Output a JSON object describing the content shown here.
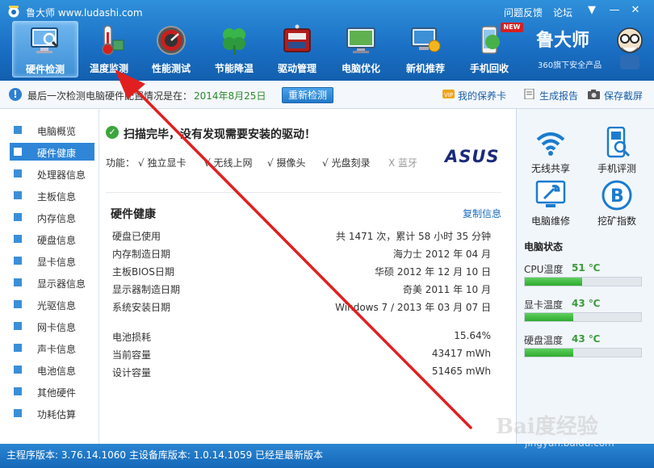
{
  "window": {
    "app_title": "鲁大师 www.ludashi.com",
    "links": [
      "问题反馈",
      "论坛"
    ]
  },
  "toolbar": {
    "items": [
      {
        "label": "硬件检测",
        "icon": "monitor-magnifier-icon",
        "active": true
      },
      {
        "label": "温度监测",
        "icon": "thermometer-icon",
        "active": false
      },
      {
        "label": "性能测试",
        "icon": "speedometer-icon",
        "active": false
      },
      {
        "label": "节能降温",
        "icon": "clover-leaf-icon",
        "active": false
      },
      {
        "label": "驱动管理",
        "icon": "driver-chip-icon",
        "active": false
      },
      {
        "label": "电脑优化",
        "icon": "screen-broom-icon",
        "active": false
      },
      {
        "label": "新机推荐",
        "icon": "computer-medal-icon",
        "active": false
      },
      {
        "label": "手机回收",
        "icon": "phone-recycle-icon",
        "active": false
      }
    ],
    "new_badge": "NEW"
  },
  "brand": {
    "name": "鲁大师",
    "subtitle": "360旗下安全产品"
  },
  "infobar": {
    "text": "最后一次检测电脑硬件配置情况是在：",
    "date": "2014年8月25日",
    "recheck_button": "重新检测",
    "links": [
      "我的保养卡",
      "生成报告",
      "保存截屏"
    ]
  },
  "sidebar": {
    "items": [
      {
        "label": "电脑概览",
        "active": false
      },
      {
        "label": "硬件健康",
        "active": true
      },
      {
        "label": "处理器信息",
        "active": false
      },
      {
        "label": "主板信息",
        "active": false
      },
      {
        "label": "内存信息",
        "active": false
      },
      {
        "label": "硬盘信息",
        "active": false
      },
      {
        "label": "显卡信息",
        "active": false
      },
      {
        "label": "显示器信息",
        "active": false
      },
      {
        "label": "光驱信息",
        "active": false
      },
      {
        "label": "网卡信息",
        "active": false
      },
      {
        "label": "声卡信息",
        "active": false
      },
      {
        "label": "电池信息",
        "active": false
      },
      {
        "label": "其他硬件",
        "active": false
      },
      {
        "label": "功耗估算",
        "active": false
      }
    ]
  },
  "scan": {
    "title": "扫描完毕，没有发现需要安装的驱动！",
    "features_label": "功能：",
    "features": [
      {
        "label": "√ 独立显卡",
        "available": true
      },
      {
        "label": "√ 无线上网",
        "available": true
      },
      {
        "label": "√ 摄像头",
        "available": true
      },
      {
        "label": "√ 光盘刻录",
        "available": true
      },
      {
        "label": "X 蓝牙",
        "available": false
      }
    ],
    "vendor_logo": "ASUS"
  },
  "health": {
    "title": "硬件健康",
    "copy_link": "复制信息",
    "rows": [
      {
        "label": "硬盘已使用",
        "value": "共 1471 次，累计 58 小时 35 分钟"
      },
      {
        "label": "内存制造日期",
        "value": "海力士 2012 年 04 月"
      },
      {
        "label": "主板BIOS日期",
        "value": "华硕 2012 年 12 月 10 日"
      },
      {
        "label": "显示器制造日期",
        "value": "奇美 2011 年 10 月"
      },
      {
        "label": "系统安装日期",
        "value": "Windows 7 / 2013 年 03 月 07 日"
      }
    ],
    "battery_rows": [
      {
        "label": "电池损耗",
        "value": "15.64%"
      },
      {
        "label": "当前容量",
        "value": "43417 mWh"
      },
      {
        "label": "设计容量",
        "value": "51465 mWh"
      }
    ]
  },
  "right_panel": {
    "tools": [
      {
        "label": "无线共享",
        "icon": "wifi-icon"
      },
      {
        "label": "手机评测",
        "icon": "phone-test-icon"
      },
      {
        "label": "电脑维修",
        "icon": "wrench-screen-icon"
      },
      {
        "label": "挖矿指数",
        "icon": "bitcoin-icon"
      }
    ],
    "status_title": "电脑状态",
    "temps": [
      {
        "label": "CPU温度",
        "value": "51 ℃",
        "level": 0.49
      },
      {
        "label": "显卡温度",
        "value": "43 ℃",
        "level": 0.42
      },
      {
        "label": "硬盘温度",
        "value": "43 ℃",
        "level": 0.42
      }
    ]
  },
  "statusbar": {
    "text": "主程序版本: 3.76.14.1060   主设备库版本: 1.0.14.1059   已经是最新版本"
  },
  "watermark": {
    "main": "Bai度经验",
    "sub": "jingyan.baidu.com"
  },
  "colors": {
    "header_blue": "#1a6fc4",
    "active_blue": "#2f86d6",
    "ok_green": "#3da53d",
    "arrow_red": "#e02020"
  }
}
